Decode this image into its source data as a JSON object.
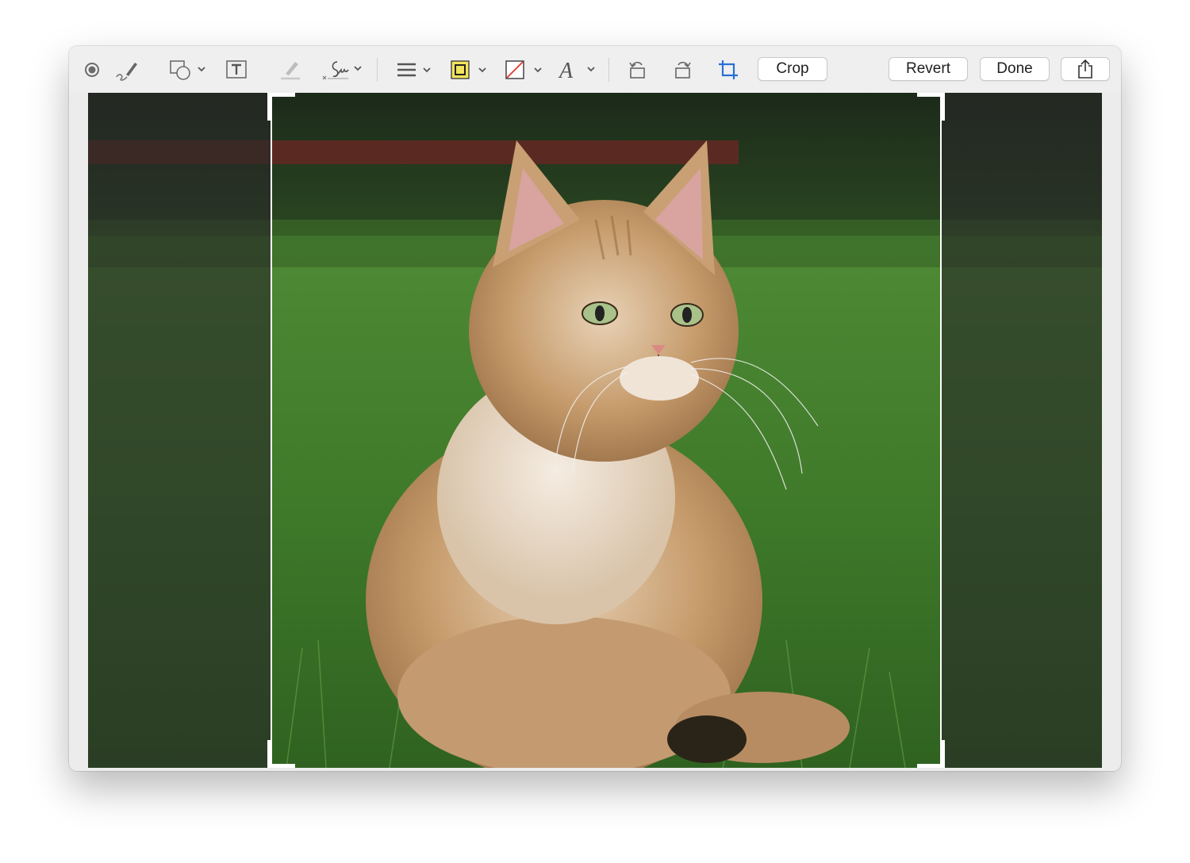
{
  "toolbar": {
    "tools": [
      {
        "name": "markup-dot-icon"
      },
      {
        "name": "sketch-icon"
      },
      {
        "name": "shapes-icon"
      },
      {
        "name": "text-box-icon"
      },
      {
        "name": "highlight-icon"
      },
      {
        "name": "signature-icon"
      },
      {
        "name": "line-style-icon"
      },
      {
        "name": "border-color-icon"
      },
      {
        "name": "fill-color-icon"
      },
      {
        "name": "text-style-icon"
      },
      {
        "name": "rotate-left-icon"
      },
      {
        "name": "rotate-right-icon"
      },
      {
        "name": "crop-icon"
      }
    ],
    "crop_label": "Crop",
    "revert_label": "Revert",
    "done_label": "Done",
    "share_icon": "share-icon"
  },
  "colors": {
    "toolbar_bg": "#efefef",
    "border_color_swatch": "#f2e45c",
    "fill_color_slash": "#e0352b",
    "crop_accent": "#2a6fd6",
    "grass": "#3f7a2a",
    "cat_fur": "#c59a6a"
  },
  "canvas": {
    "image_subject": "cat-photo"
  }
}
